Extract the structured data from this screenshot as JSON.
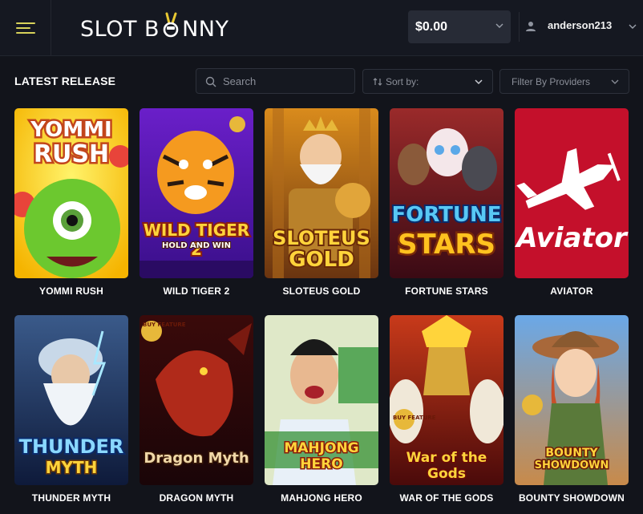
{
  "header": {
    "logo": {
      "left": "SLOT B",
      "right": "NNY"
    },
    "balance": "$0.00",
    "username": "anderson213"
  },
  "toolbar": {
    "section_title": "LATEST RELEASE",
    "search_placeholder": "Search",
    "sort_label": "Sort by:",
    "filter_label": "Filter By Providers"
  },
  "games": [
    {
      "title": "YOMMI RUSH",
      "art_line1": "YOMMI",
      "art_line2": "RUSH"
    },
    {
      "title": "WILD TIGER 2",
      "art_line1": "WILD TIGER 2",
      "art_line2": "HOLD AND WIN"
    },
    {
      "title": "SLOTEUS GOLD",
      "art_line1": "SLOTEUS",
      "art_line2": "GOLD"
    },
    {
      "title": "FORTUNE STARS",
      "art_line1": "FORTUNE",
      "art_line2": "STARS"
    },
    {
      "title": "AVIATOR",
      "art_line1": "Aviator",
      "art_line2": ""
    },
    {
      "title": "THUNDER MYTH",
      "art_line1": "THUNDER",
      "art_line2": "MYTH"
    },
    {
      "title": "DRAGON MYTH",
      "art_line1": "Dragon Myth",
      "art_line2": "BUY FEATURE"
    },
    {
      "title": "MAHJONG HERO",
      "art_line1": "MAHJONG HERO",
      "art_line2": ""
    },
    {
      "title": "WAR OF THE GODS",
      "art_line1": "War of the Gods",
      "art_line2": "BUY FEATURE"
    },
    {
      "title": "BOUNTY SHOWDOWN",
      "art_line1": "BOUNTY",
      "art_line2": "SHOWDOWN"
    }
  ]
}
